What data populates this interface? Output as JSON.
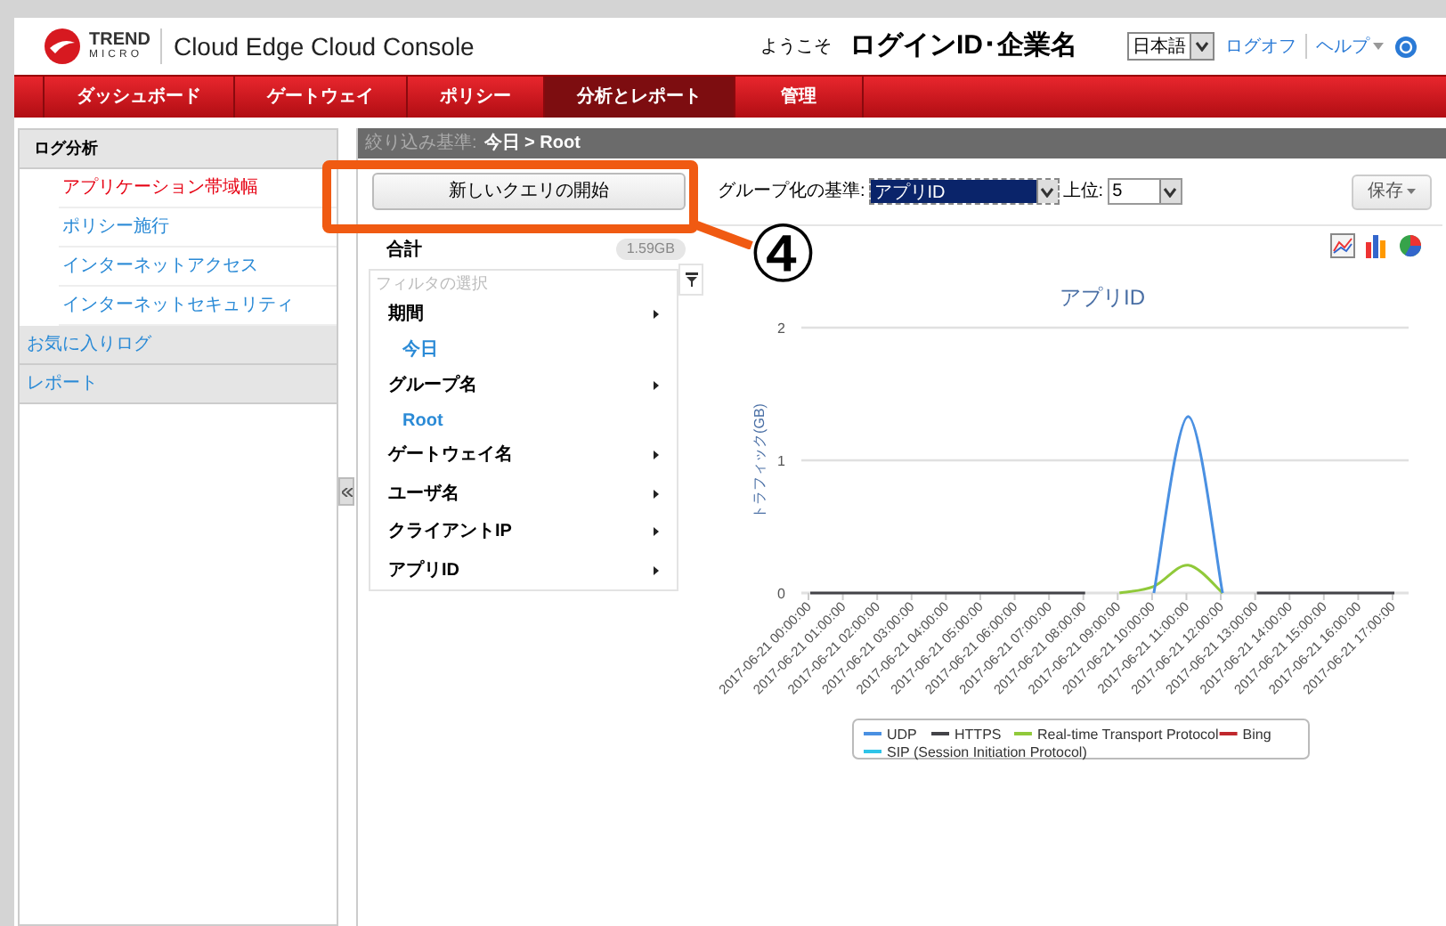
{
  "header": {
    "logo_text": "TREND",
    "logo_subtext": "MICRO",
    "product": "Cloud Edge Cloud Console",
    "welcome": "ようこそ",
    "user": "ログインID･企業名",
    "language": "日本語",
    "links": [
      "ログオフ",
      "ヘルプ"
    ]
  },
  "nav": [
    {
      "label": "ダッシュボード",
      "selected": false
    },
    {
      "label": "ゲートウェイ",
      "selected": false
    },
    {
      "label": "ポリシー",
      "selected": false
    },
    {
      "label": "分析とレポート",
      "selected": true
    },
    {
      "label": "管理",
      "selected": false
    }
  ],
  "sidebar": [
    {
      "label": "ログ分析",
      "kind": "section",
      "children": [
        {
          "label": "アプリケーション帯域幅",
          "selected": true
        },
        {
          "label": "ポリシー施行",
          "selected": false
        },
        {
          "label": "インターネットアクセス",
          "selected": false
        },
        {
          "label": "インターネットセキュリティ",
          "selected": false
        }
      ]
    },
    {
      "label": "お気に入りログ",
      "kind": "link"
    },
    {
      "label": "レポート",
      "kind": "link"
    }
  ],
  "breadcrumb": {
    "label": "絞り込み基準:",
    "value": "今日 > Root"
  },
  "toolbar": {
    "new_query": "新しいクエリの開始",
    "group_label": "グループ化の基準:",
    "group_value": "アプリID",
    "top_label": "上位:",
    "top_value": "5",
    "save": "保存"
  },
  "summary": {
    "label": "合計",
    "value": "1.59GB"
  },
  "filter": {
    "placeholder": "フィルタの選択",
    "items": [
      {
        "kind": "category",
        "label": "期間"
      },
      {
        "kind": "value",
        "label": "今日"
      },
      {
        "kind": "category",
        "label": "グループ名"
      },
      {
        "kind": "value",
        "label": "Root"
      },
      {
        "kind": "category",
        "label": "ゲートウェイ名"
      },
      {
        "kind": "category",
        "label": "ユーザ名"
      },
      {
        "kind": "category",
        "label": "クライアントIP"
      },
      {
        "kind": "category",
        "label": "アプリID"
      }
    ]
  },
  "chart": {
    "chart_data": {
      "type": "line",
      "title": "アプリID",
      "ylabel": "トラフィック(GB)",
      "categories": [
        "2017-06-21 00:00:00",
        "2017-06-21 01:00:00",
        "2017-06-21 02:00:00",
        "2017-06-21 03:00:00",
        "2017-06-21 04:00:00",
        "2017-06-21 05:00:00",
        "2017-06-21 06:00:00",
        "2017-06-21 07:00:00",
        "2017-06-21 08:00:00",
        "2017-06-21 09:00:00",
        "2017-06-21 10:00:00",
        "2017-06-21 11:00:00",
        "2017-06-21 12:00:00",
        "2017-06-21 13:00:00",
        "2017-06-21 14:00:00",
        "2017-06-21 15:00:00",
        "2017-06-21 16:00:00",
        "2017-06-21 17:00:00"
      ],
      "series": [
        {
          "name": "UDP",
          "color": "#4a90e2",
          "values": [
            null,
            null,
            null,
            null,
            null,
            null,
            null,
            null,
            null,
            null,
            0,
            1.33,
            0,
            null,
            null,
            null,
            null,
            null
          ]
        },
        {
          "name": "HTTPS",
          "color": "#434348",
          "values": [
            0,
            0,
            0,
            0,
            0,
            0,
            0,
            0,
            0,
            null,
            null,
            null,
            null,
            0,
            0,
            0,
            0,
            0
          ]
        },
        {
          "name": "Real-time Transport Protocol",
          "color": "#90c93a",
          "values": [
            null,
            null,
            null,
            null,
            null,
            null,
            null,
            null,
            null,
            0,
            0.05,
            0.21,
            0,
            null,
            null,
            null,
            null,
            null
          ]
        },
        {
          "name": "Bing",
          "color": "#c0282d",
          "values": [
            null,
            null,
            null,
            null,
            null,
            null,
            null,
            null,
            null,
            null,
            null,
            null,
            null,
            null,
            null,
            null,
            null,
            null
          ]
        },
        {
          "name": "SIP (Session Initiation Protocol)",
          "color": "#2fc4e8",
          "values": [
            null,
            null,
            null,
            null,
            null,
            null,
            null,
            null,
            null,
            null,
            null,
            null,
            null,
            null,
            null,
            null,
            null,
            null
          ]
        }
      ],
      "ylim": [
        0,
        2
      ],
      "yticks": [
        0,
        1,
        2
      ],
      "legend": "bottom"
    }
  },
  "annotation": {
    "label": "④"
  }
}
